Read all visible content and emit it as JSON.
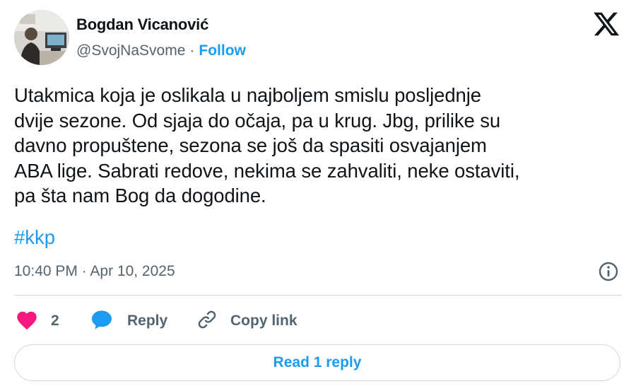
{
  "author": {
    "name": "Bogdan Vicanović",
    "handle": "@SvojNaSvome",
    "separator": "·",
    "follow_label": "Follow"
  },
  "tweet": {
    "lines": [
      "Utakmica koja je oslikala u najboljem smislu posljednje",
      "dvije sezone. Od sjaja do očaja, pa u krug. Jbg, prilike su",
      "davno propuštene, sezona se još da spasiti osvajanjem",
      "ABA lige. Sabrati redove, nekima se zahvaliti, neke ostaviti,",
      "pa šta nam Bog da dogodine."
    ],
    "hashtag": "#kkp",
    "timestamp": "10:40 PM · Apr 10, 2025"
  },
  "actions": {
    "like_count": "2",
    "reply_label": "Reply",
    "copy_link_label": "Copy link"
  },
  "read_replies_label": "Read 1 reply",
  "icons": {
    "platform": "x-logo-icon",
    "info": "info-icon",
    "like": "heart-icon",
    "reply": "speech-bubble-icon",
    "copy": "link-icon"
  },
  "colors": {
    "accent": "#1d9bf0",
    "like": "#f91880",
    "muted": "#536471",
    "text": "#0f1419",
    "border": "#cfd9de"
  }
}
